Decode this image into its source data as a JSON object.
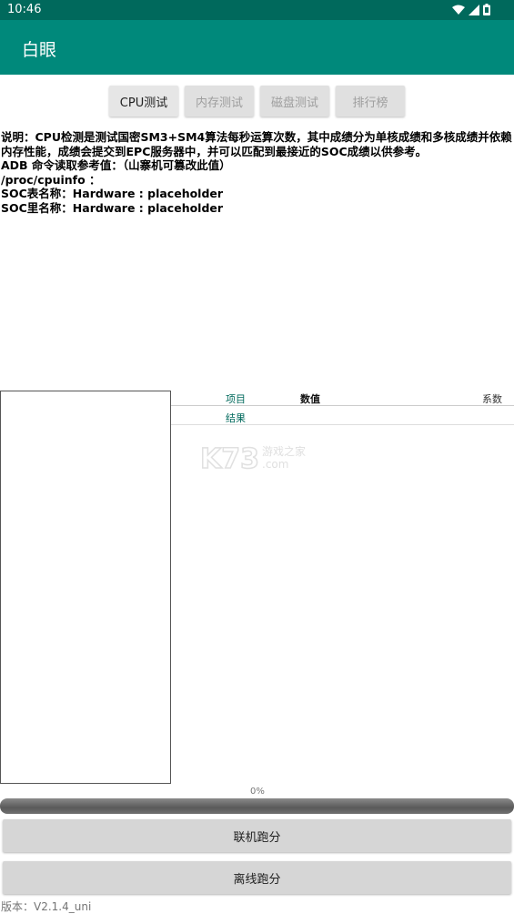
{
  "status_bar": {
    "time": "10:46",
    "icons": [
      "wifi-icon",
      "signal-icon",
      "battery-icon"
    ]
  },
  "app_bar": {
    "title": "白眼"
  },
  "tabs": [
    {
      "label": "CPU测试",
      "active": true
    },
    {
      "label": "内存测试",
      "active": false
    },
    {
      "label": "磁盘测试",
      "active": false
    },
    {
      "label": "排行榜",
      "active": false
    }
  ],
  "description": {
    "line1": "说明：CPU检测是测试国密SM3+SM4算法每秒运算次数，其中成绩分为单核成绩和多核成绩并依赖内存性能，成绩会提交到EPC服务器中，并可以匹配到最接近的SOC成绩以供参考。",
    "line2": "ADB 命令读取参考值：（山寨机可篡改此值）",
    "line3": "/proc/cpuinfo ：",
    "line4": "SOC表名称：Hardware : placeholder",
    "line5": "SOC里名称：Hardware : placeholder"
  },
  "table": {
    "col_item": "项目",
    "col_value": "数值",
    "col_coef": "系数",
    "row_result": "结果"
  },
  "watermark": {
    "brand": "K73",
    "text1": "游戏之家",
    "text2": ".com"
  },
  "progress": {
    "label": "0%",
    "value": 0
  },
  "buttons": {
    "online": "联机跑分",
    "offline": "离线跑分"
  },
  "version": "版本：V2.1.4_uni",
  "colors": {
    "status_bar": "#00695c",
    "app_bar": "#00897b",
    "accent": "#00695c"
  }
}
